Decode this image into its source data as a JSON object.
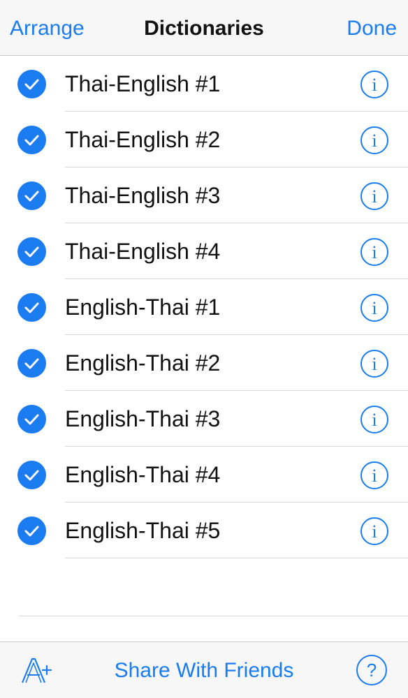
{
  "navbar": {
    "left_label": "Arrange",
    "title": "Dictionaries",
    "right_label": "Done"
  },
  "dictionaries": [
    {
      "label": "Thai-English #1",
      "checked": true
    },
    {
      "label": "Thai-English #2",
      "checked": true
    },
    {
      "label": "Thai-English #3",
      "checked": true
    },
    {
      "label": "Thai-English #4",
      "checked": true
    },
    {
      "label": "English-Thai #1",
      "checked": true
    },
    {
      "label": "English-Thai #2",
      "checked": true
    },
    {
      "label": "English-Thai #3",
      "checked": true
    },
    {
      "label": "English-Thai #4",
      "checked": true
    },
    {
      "label": "English-Thai #5",
      "checked": true
    }
  ],
  "toolbar": {
    "font_icon": "font-size-increase-icon",
    "share_label": "Share With Friends",
    "help_icon": "help-icon"
  },
  "colors": {
    "accent": "#1a7cf0",
    "text": "#111111",
    "bar_background": "#f7f7f8",
    "separator": "#d6d6da"
  }
}
